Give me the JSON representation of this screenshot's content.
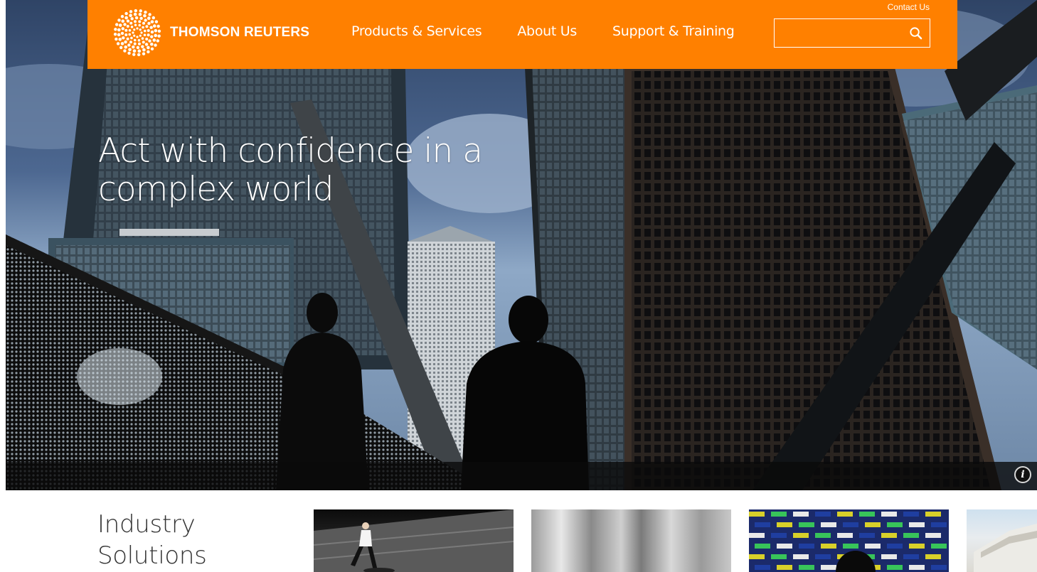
{
  "colors": {
    "brand_orange": "#ff8000",
    "header_text": "#ffffff",
    "body_text": "#333333"
  },
  "header": {
    "logo_text": "THOMSON REUTERS",
    "logo_icon": "thomson-reuters-dot-sphere",
    "nav": [
      {
        "label": "Products & Services"
      },
      {
        "label": "About Us"
      },
      {
        "label": "Support & Training"
      }
    ],
    "contact_label": "Contact Us",
    "search": {
      "placeholder": "",
      "value": "",
      "icon": "search-icon"
    }
  },
  "hero": {
    "headline_line1": "Act with confidence in a",
    "headline_line2": "complex world",
    "info_icon": "i"
  },
  "section": {
    "title_line1": "Industry",
    "title_line2": "Solutions"
  }
}
